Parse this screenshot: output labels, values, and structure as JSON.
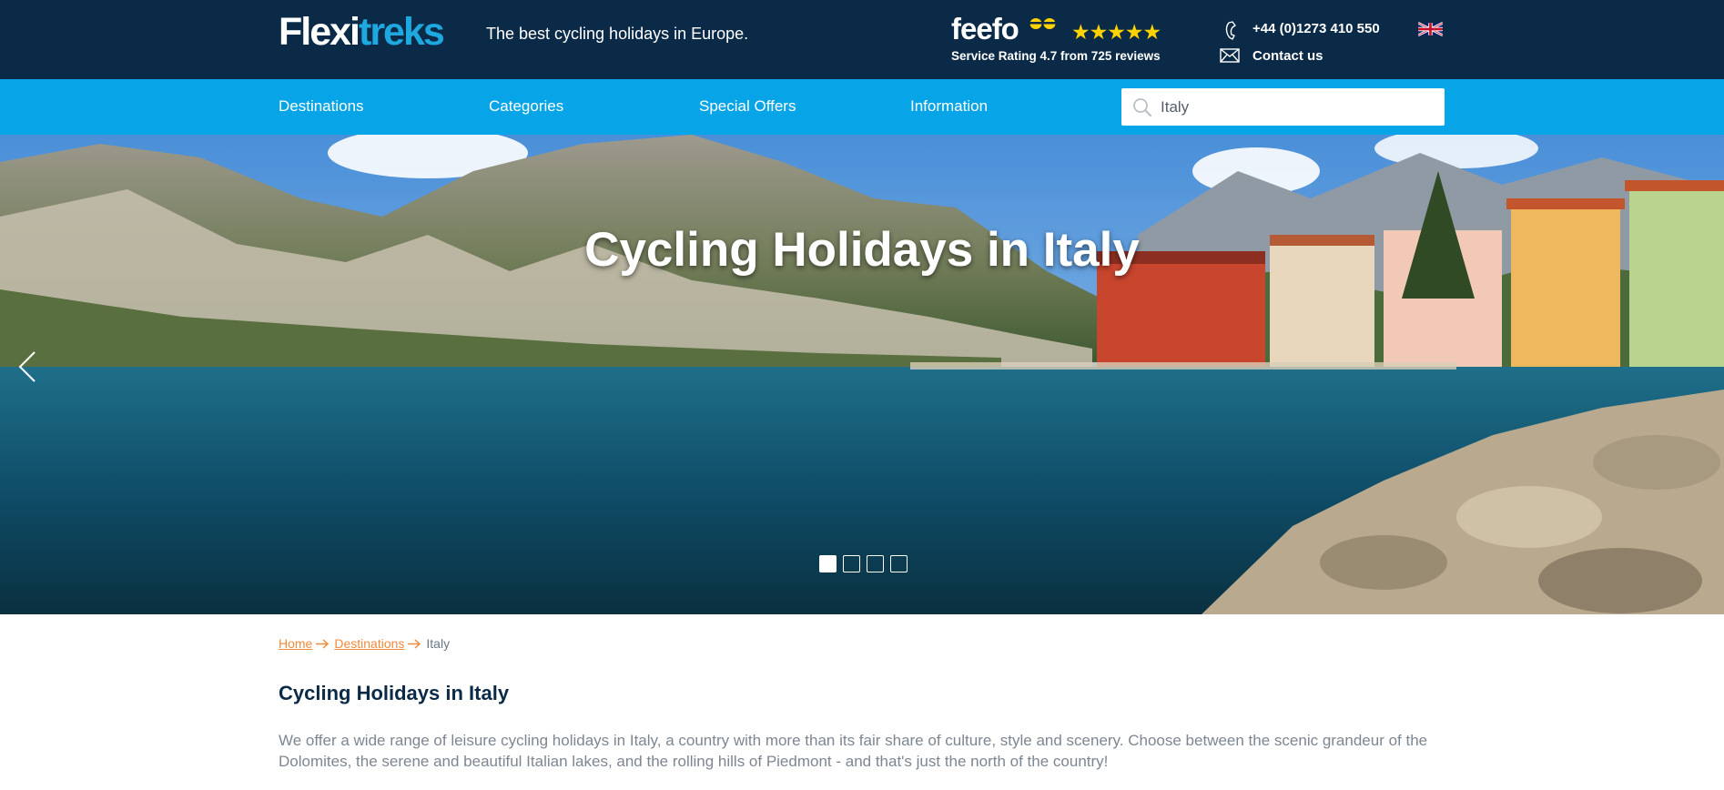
{
  "header": {
    "logo_part1": "Flexi",
    "logo_part2": "treks",
    "tagline": "The best cycling holidays in Europe.",
    "feefo": {
      "brand": "feefo",
      "stars": "★★★★★",
      "star_count": 5,
      "rating_text": "Service Rating 4.7 from 725 reviews"
    },
    "phone": "+44 (0)1273 410 550",
    "contact_label": "Contact us",
    "language_flag": "uk-flag-icon"
  },
  "nav": {
    "items": [
      {
        "label": "Destinations"
      },
      {
        "label": "Categories"
      },
      {
        "label": "Special Offers"
      },
      {
        "label": "Information"
      }
    ],
    "search": {
      "value": "Italy",
      "icon": "search-icon"
    }
  },
  "hero": {
    "title": "Cycling Holidays in Italy",
    "slide_count": 4,
    "active_slide": 1
  },
  "breadcrumb": {
    "items": [
      "Home",
      "Destinations"
    ],
    "current": "Italy"
  },
  "content": {
    "title": "Cycling Holidays in Italy",
    "intro": "We offer a wide range of leisure cycling holidays in Italy, a country with more than its fair share of culture, style and scenery. Choose between the scenic grandeur of the Dolomites, the serene and beautiful Italian lakes, and the rolling hills of Piedmont - and that's just the north of the country!"
  },
  "colors": {
    "header_bg": "#0b2a47",
    "nav_bg": "#07a5e7",
    "accent_blue": "#1ea8e0",
    "link_orange": "#f08a3c",
    "star_yellow": "#ffd200"
  }
}
